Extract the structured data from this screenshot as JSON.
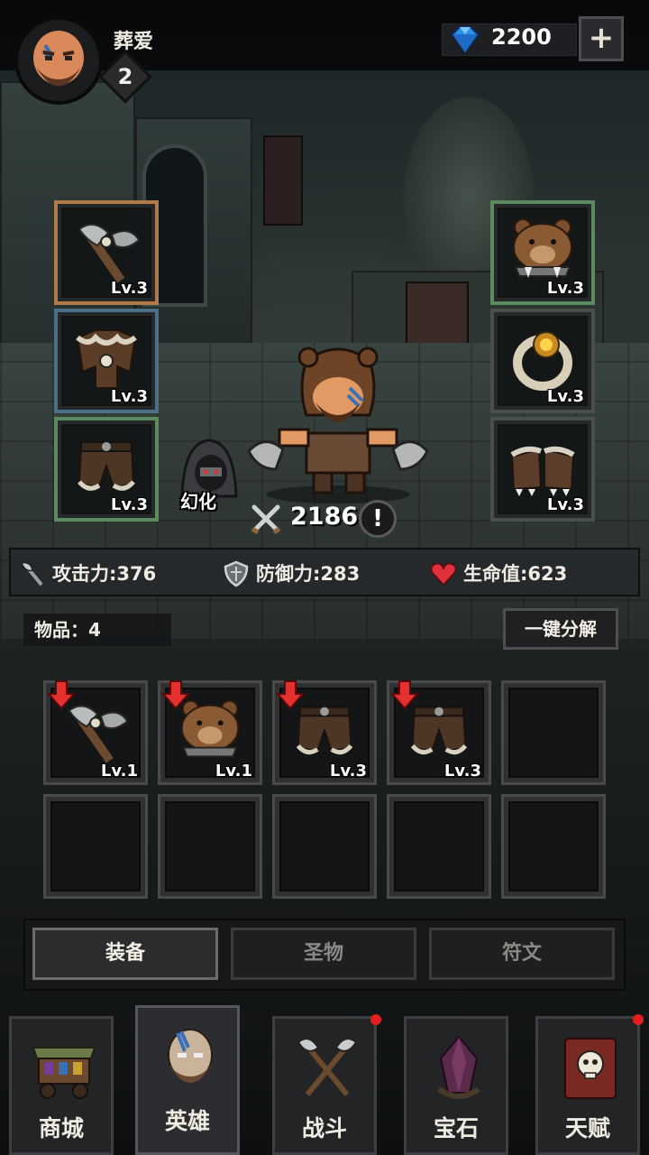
{
  "player": {
    "name": "葬爱",
    "level": "2"
  },
  "currency": {
    "gems": "2200",
    "add_label": "+"
  },
  "equipped_left": [
    {
      "icon": "axe-icon",
      "level": "Lv.3",
      "rarity": "bronze"
    },
    {
      "icon": "fur-armor-icon",
      "level": "Lv.3",
      "rarity": "blue"
    },
    {
      "icon": "fur-pants-icon",
      "level": "Lv.3",
      "rarity": "green"
    }
  ],
  "equipped_right": [
    {
      "icon": "bear-helmet-icon",
      "level": "Lv.3",
      "rarity": "green"
    },
    {
      "icon": "ring-icon",
      "level": "Lv.3",
      "rarity": "gray"
    },
    {
      "icon": "bear-boots-icon",
      "level": "Lv.3",
      "rarity": "gray"
    }
  ],
  "hero": {
    "transform_label": "幻化",
    "power": "2186",
    "alert": "!"
  },
  "stats": {
    "attack": {
      "label": "攻击力",
      "value": "376"
    },
    "defense": {
      "label": "防御力",
      "value": "283"
    },
    "hp": {
      "label": "生命值",
      "value": "623"
    }
  },
  "inventory": {
    "count_label": "物品：4",
    "dismantle_label": "一键分解",
    "items": [
      {
        "icon": "axe-icon",
        "level": "Lv.1",
        "downgrade": true
      },
      {
        "icon": "bear-helmet-icon",
        "level": "Lv.1",
        "downgrade": true
      },
      {
        "icon": "fur-pants-icon",
        "level": "Lv.3",
        "downgrade": true
      },
      {
        "icon": "fur-pants-icon",
        "level": "Lv.3",
        "downgrade": true
      }
    ]
  },
  "tabs": [
    {
      "label": "装备",
      "active": true
    },
    {
      "label": "圣物",
      "active": false
    },
    {
      "label": "符文",
      "active": false
    }
  ],
  "nav": [
    {
      "label": "商城",
      "icon": "shop-cart-icon",
      "active": false,
      "notify": false
    },
    {
      "label": "英雄",
      "icon": "hero-icon",
      "active": true,
      "notify": false
    },
    {
      "label": "战斗",
      "icon": "crossed-axes-icon",
      "active": false,
      "notify": true
    },
    {
      "label": "宝石",
      "icon": "crystal-icon",
      "active": false,
      "notify": false
    },
    {
      "label": "天赋",
      "icon": "skull-book-icon",
      "active": false,
      "notify": true
    }
  ],
  "colors": {
    "accent_red": "#e51f1f",
    "gem_blue": "#2f8fe8",
    "bronze": "#b07a4a",
    "blue": "#4b6f86",
    "green": "#5b8a5e"
  }
}
